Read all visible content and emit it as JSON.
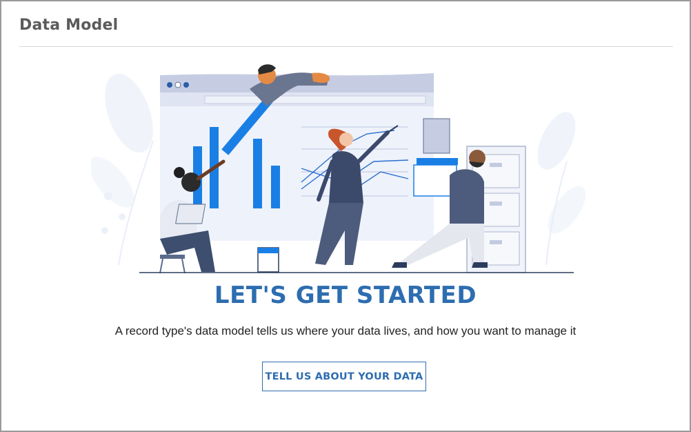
{
  "header": {
    "title": "Data Model"
  },
  "empty_state": {
    "headline": "LET'S GET STARTED",
    "description": "A record type's data model tells us where your data lives, and how you want to manage it",
    "cta_label": "TELL US ABOUT YOUR DATA",
    "illustration_icon": "team-building-chart-illustration"
  },
  "colors": {
    "accent": "#2d6db0",
    "title_gray": "#5b5b5b",
    "bar_blue": "#1a7fe5"
  }
}
